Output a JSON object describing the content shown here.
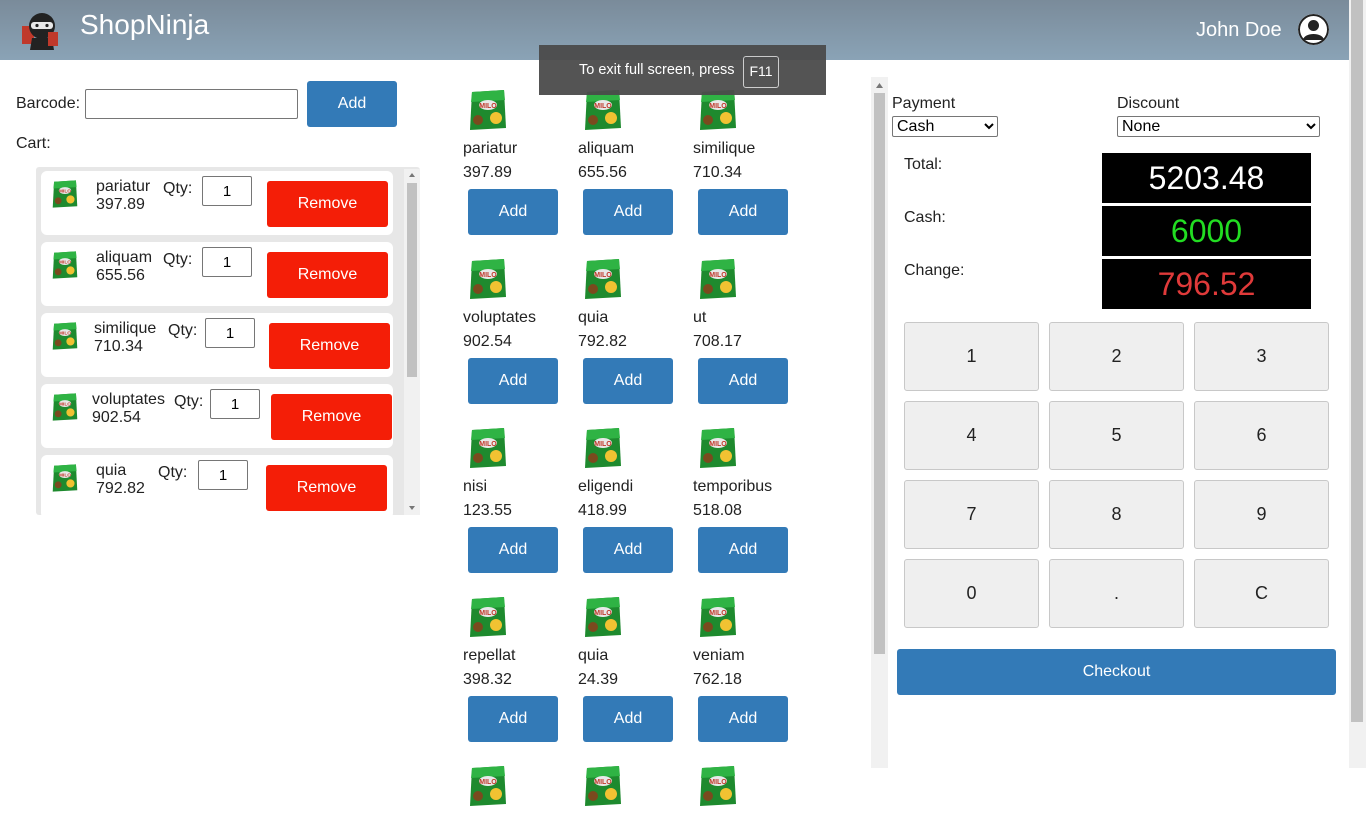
{
  "header": {
    "brand": "ShopNinja",
    "user_name": "John Doe"
  },
  "toast": {
    "message": "To exit full screen, press",
    "key": "F11"
  },
  "left": {
    "barcode_label": "Barcode:",
    "barcode_value": "",
    "add_label": "Add",
    "cart_label": "Cart:",
    "qty_label": "Qty:",
    "remove_label": "Remove",
    "cart_items": [
      {
        "name": "pariatur",
        "price": "397.89",
        "qty": "1"
      },
      {
        "name": "aliquam",
        "price": "655.56",
        "qty": "1"
      },
      {
        "name": "similique",
        "price": "710.34",
        "qty": "1"
      },
      {
        "name": "voluptates",
        "price": "902.54",
        "qty": "1"
      },
      {
        "name": "quia",
        "price": "792.82",
        "qty": "1"
      }
    ]
  },
  "products": {
    "add_label": "Add",
    "items": [
      {
        "name": "pariatur",
        "price": "397.89"
      },
      {
        "name": "aliquam",
        "price": "655.56"
      },
      {
        "name": "similique",
        "price": "710.34"
      },
      {
        "name": "voluptates",
        "price": "902.54"
      },
      {
        "name": "quia",
        "price": "792.82"
      },
      {
        "name": "ut",
        "price": "708.17"
      },
      {
        "name": "nisi",
        "price": "123.55"
      },
      {
        "name": "eligendi",
        "price": "418.99"
      },
      {
        "name": "temporibus",
        "price": "518.08"
      },
      {
        "name": "repellat",
        "price": "398.32"
      },
      {
        "name": "quia",
        "price": "24.39"
      },
      {
        "name": "veniam",
        "price": "762.18"
      }
    ]
  },
  "right": {
    "payment_label": "Payment",
    "payment_value": "Cash",
    "discount_label": "Discount",
    "discount_value": "None",
    "total_label": "Total:",
    "total_value": "5203.48",
    "cash_label": "Cash:",
    "cash_value": "6000",
    "change_label": "Change:",
    "change_value": "796.52",
    "keys": [
      "1",
      "2",
      "3",
      "4",
      "5",
      "6",
      "7",
      "8",
      "9",
      "0",
      ".",
      "C"
    ],
    "checkout_label": "Checkout"
  },
  "colors": {
    "total": "#ffffff",
    "cash": "#22dd22",
    "change": "#e03a3a",
    "accent": "#337ab7",
    "danger": "#f41e07"
  }
}
